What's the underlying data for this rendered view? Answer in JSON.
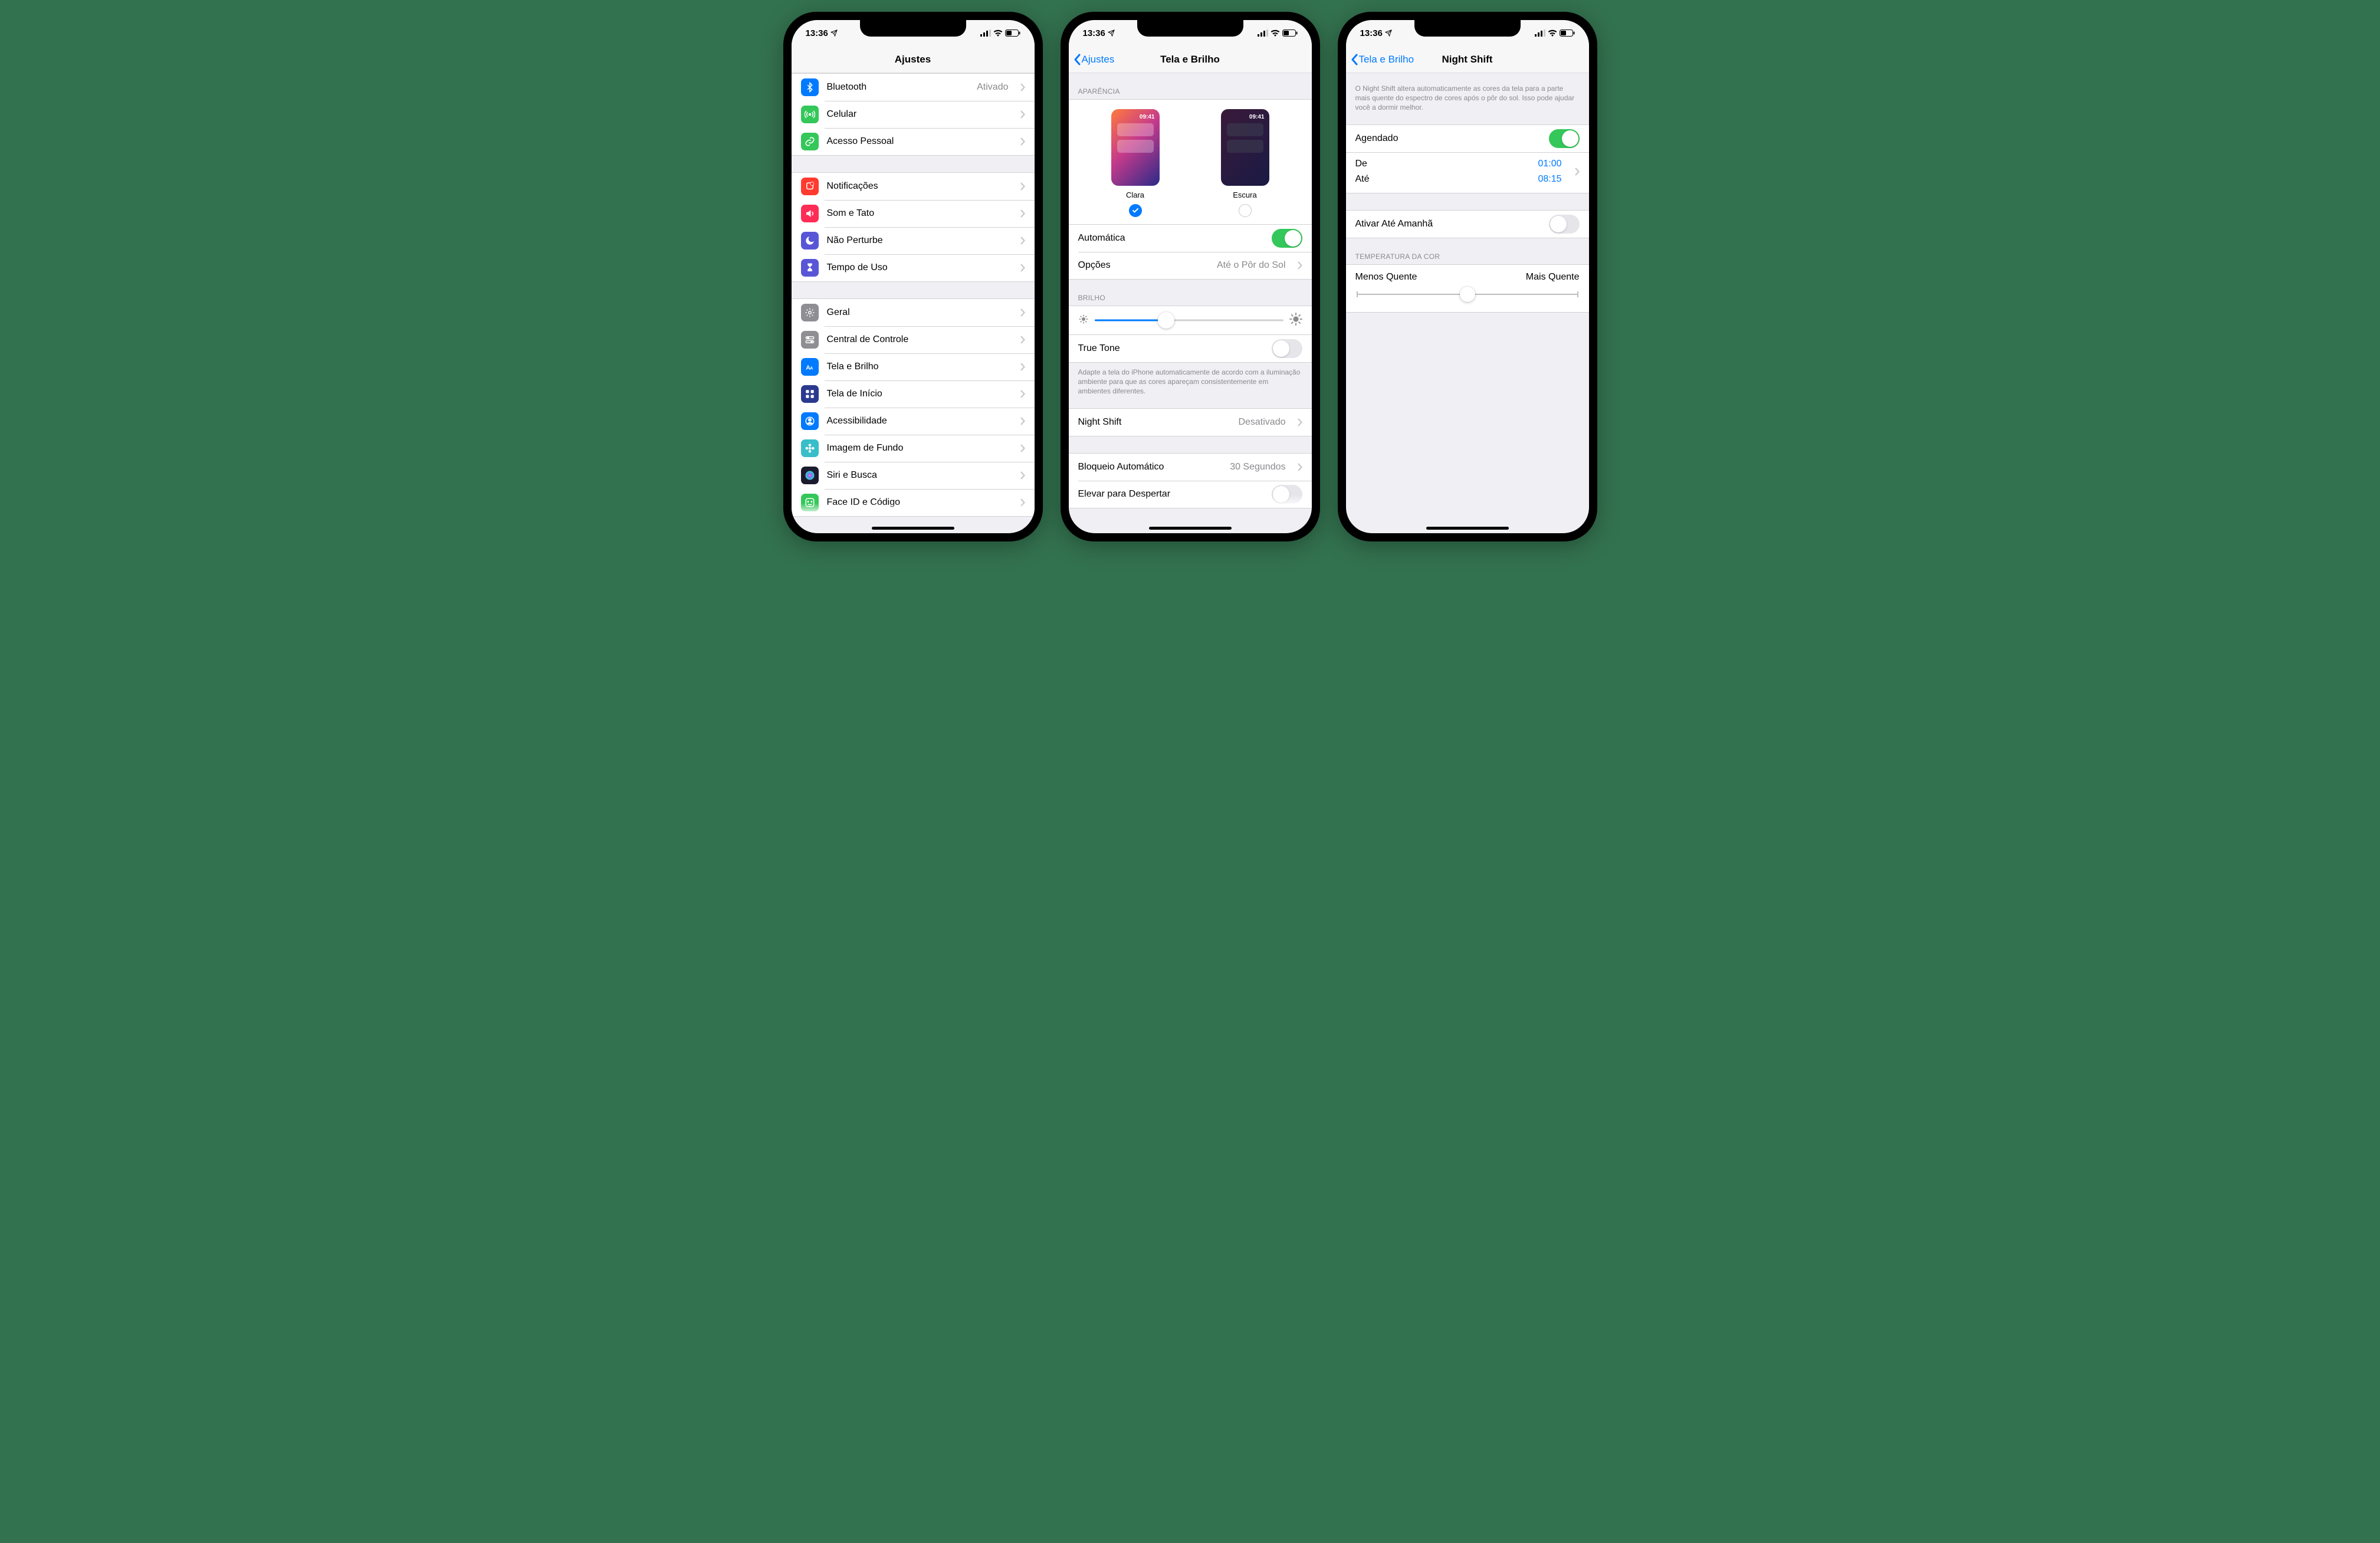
{
  "status": {
    "time": "13:36"
  },
  "phone1": {
    "title": "Ajustes",
    "group1": [
      {
        "label": "Bluetooth",
        "value": "Ativado",
        "iconColor": "#007aff",
        "icon": "bluetooth"
      },
      {
        "label": "Celular",
        "iconColor": "#34c759",
        "icon": "antenna"
      },
      {
        "label": "Acesso Pessoal",
        "iconColor": "#34c759",
        "icon": "link"
      }
    ],
    "group2": [
      {
        "label": "Notificações",
        "iconColor": "#ff3b30",
        "icon": "bell"
      },
      {
        "label": "Som e Tato",
        "iconColor": "#ff2d55",
        "icon": "speaker"
      },
      {
        "label": "Não Perturbe",
        "iconColor": "#5856d6",
        "icon": "moon"
      },
      {
        "label": "Tempo de Uso",
        "iconColor": "#5856d6",
        "icon": "hourglass"
      }
    ],
    "group3": [
      {
        "label": "Geral",
        "iconColor": "#8e8e93",
        "icon": "gear"
      },
      {
        "label": "Central de Controle",
        "iconColor": "#8e8e93",
        "icon": "toggles"
      },
      {
        "label": "Tela e Brilho",
        "iconColor": "#007aff",
        "icon": "aa"
      },
      {
        "label": "Tela de Início",
        "iconColor": "#2b3a8f",
        "icon": "grid"
      },
      {
        "label": "Acessibilidade",
        "iconColor": "#007aff",
        "icon": "person"
      },
      {
        "label": "Imagem de Fundo",
        "iconColor": "#38bec9",
        "icon": "flower"
      },
      {
        "label": "Siri e Busca",
        "iconColor": "#1b1b2f",
        "icon": "siri"
      },
      {
        "label": "Face ID e Código",
        "iconColor": "#34c759",
        "icon": "face"
      }
    ]
  },
  "phone2": {
    "back": "Ajustes",
    "title": "Tela e Brilho",
    "section_appearance": "APARÊNCIA",
    "appearance": {
      "light": "Clara",
      "dark": "Escura",
      "preview_time": "09:41",
      "selected": "light"
    },
    "automatic": {
      "label": "Automática",
      "on": true
    },
    "options": {
      "label": "Opções",
      "value": "Até o Pôr do Sol"
    },
    "section_brightness": "BRILHO",
    "brightness_pct": 38,
    "truetone": {
      "label": "True Tone",
      "on": false
    },
    "truetone_footer": "Adapte a tela do iPhone automaticamente de acordo com a iluminação ambiente para que as cores apareçam consistentemente em ambientes diferentes.",
    "nightshift": {
      "label": "Night Shift",
      "value": "Desativado"
    },
    "autolock": {
      "label": "Bloqueio Automático",
      "value": "30 Segundos"
    },
    "raise": "Elevar para Despertar"
  },
  "phone3": {
    "back": "Tela e Brilho",
    "title": "Night Shift",
    "intro": "O Night Shift altera automaticamente as cores da tela para a parte mais quente do espectro de cores após o pôr do sol. Isso pode ajudar você a dormir melhor.",
    "scheduled": {
      "label": "Agendado",
      "on": true
    },
    "from_label": "De",
    "from_val": "01:00",
    "to_label": "Até",
    "to_val": "08:15",
    "enable_tomorrow": {
      "label": "Ativar Até Amanhã",
      "on": false
    },
    "section_temp": "TEMPERATURA DA COR",
    "temp_less": "Menos Quente",
    "temp_more": "Mais Quente",
    "temp_pct": 50
  }
}
